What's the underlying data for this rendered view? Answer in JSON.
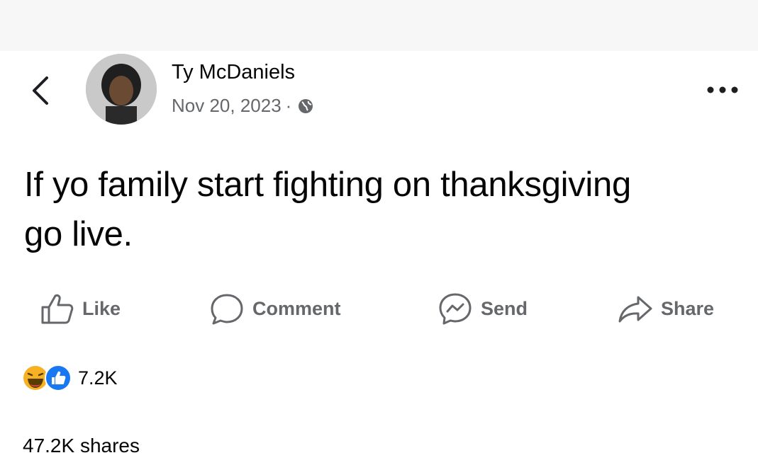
{
  "post": {
    "author": "Ty McDaniels",
    "date": "Nov 20, 2023",
    "separator": "·",
    "text": "If yo family start fighting on thanksgiving go live."
  },
  "actions": {
    "like": "Like",
    "comment": "Comment",
    "send": "Send",
    "share": "Share"
  },
  "reactions": {
    "count": "7.2K",
    "types": [
      "haha",
      "like"
    ]
  },
  "shares": "47.2K shares",
  "icons": {
    "back": "chevron-left-icon",
    "privacy": "globe-icon",
    "more": "more-horizontal-icon"
  },
  "colors": {
    "text": "#050505",
    "secondary": "#65676b",
    "like_blue": "#1877f2",
    "haha_yellow": "#f7b125"
  }
}
